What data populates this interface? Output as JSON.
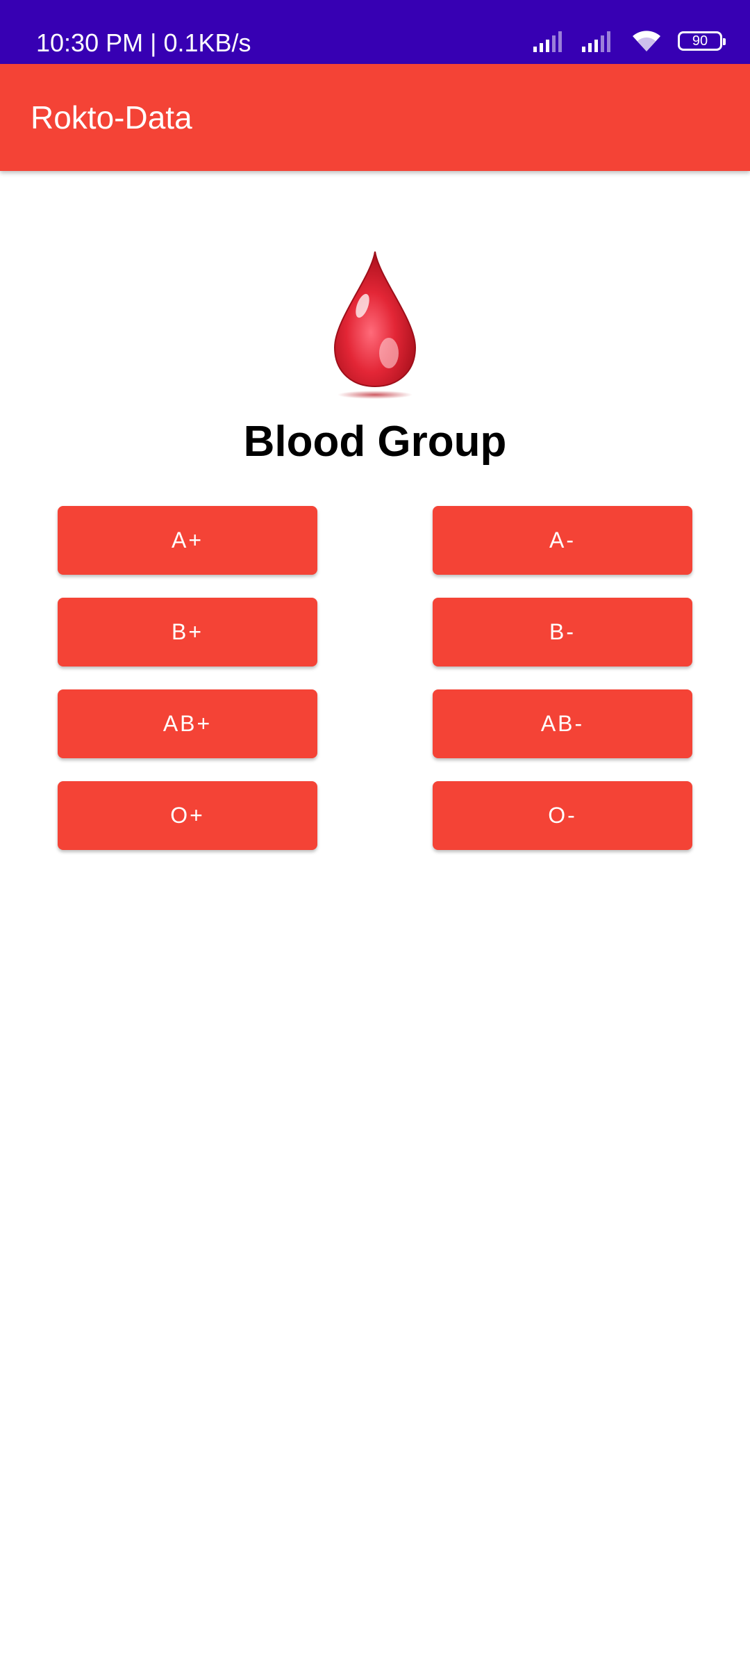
{
  "status_bar": {
    "time_speed": "10:30 PM | 0.1KB/s",
    "battery_level": "90",
    "background_color": "#3700b3",
    "icons": [
      "signal-icon",
      "signal-icon",
      "wifi-icon",
      "battery-icon"
    ]
  },
  "app_bar": {
    "title": "Rokto-Data",
    "background_color": "#f44336"
  },
  "main": {
    "logo_icon": "blood-drop-icon",
    "heading": "Blood Group",
    "buttons": [
      {
        "label": "A+"
      },
      {
        "label": "A-"
      },
      {
        "label": "B+"
      },
      {
        "label": "B-"
      },
      {
        "label": "AB+"
      },
      {
        "label": "AB-"
      },
      {
        "label": "O+"
      },
      {
        "label": "O-"
      }
    ],
    "button_color": "#f44336"
  }
}
